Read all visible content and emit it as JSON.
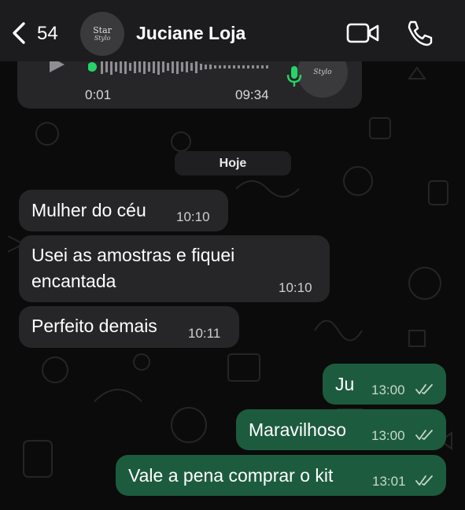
{
  "header": {
    "unread_count": "54",
    "contact_name": "Juciane Loja",
    "avatar_text_1": "Star",
    "avatar_text_2": "Stylo"
  },
  "voice_message": {
    "duration": "0:01",
    "time": "09:34",
    "avatar_text": "Stylo"
  },
  "date_separator": "Hoje",
  "incoming": [
    {
      "text": "Mulher do céu",
      "time": "10:10"
    },
    {
      "text_line1": "Usei as amostras e fiquei",
      "text_line2": "encantada",
      "time": "10:10"
    },
    {
      "text": "Perfeito demais",
      "time": "10:11"
    }
  ],
  "outgoing": [
    {
      "text": "Ju",
      "time": "13:00",
      "status": "read"
    },
    {
      "text": "Maravilhoso",
      "time": "13:00",
      "status": "read"
    },
    {
      "text": "Vale a pena comprar o kit",
      "time": "13:01",
      "status": "read"
    }
  ],
  "colors": {
    "header_bg": "#1c1c1e",
    "incoming_bubble": "#262628",
    "outgoing_bubble": "#1d5b3f",
    "accent_green": "#25d366"
  }
}
